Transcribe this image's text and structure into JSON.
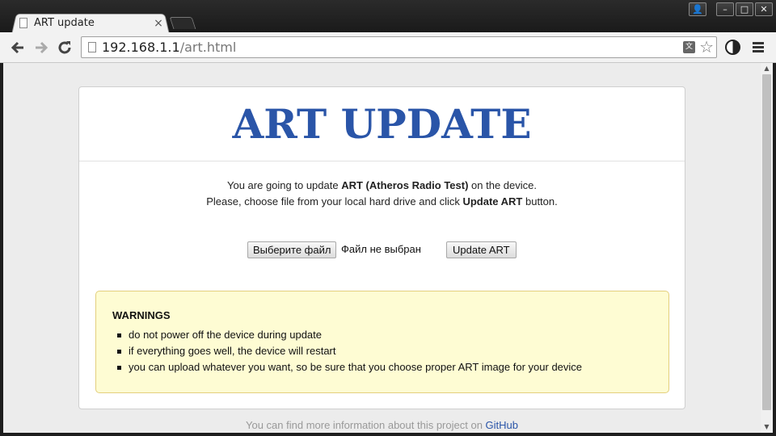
{
  "browser": {
    "tab_title": "ART update",
    "tab_close": "×",
    "url_host": "192.168.1.1",
    "url_path": "/art.html",
    "icons": {
      "back": "back-arrow-icon",
      "forward": "forward-arrow-icon",
      "reload": "reload-icon",
      "translate": "translate-icon",
      "star": "star-icon",
      "extension": "extension-icon",
      "menu": "menu-icon"
    },
    "translate_glyph": "文",
    "star_glyph": "☆",
    "window_controls": {
      "user": "👤",
      "minimize": "–",
      "maximize": "□",
      "close": "✕"
    }
  },
  "page": {
    "title": "ART UPDATE",
    "intro_line1_pre": "You are going to update ",
    "intro_line1_bold": "ART (Atheros Radio Test)",
    "intro_line1_post": " on the device.",
    "intro_line2_pre": "Please, choose file from your local hard drive and click ",
    "intro_line2_bold": "Update ART",
    "intro_line2_post": " button.",
    "file_button": "Выберите файл",
    "file_status": "Файл не выбран",
    "update_button": "Update ART",
    "warnings_title": "WARNINGS",
    "warnings": [
      "do not power off the device during update",
      "if everything goes well, the device will restart",
      "you can upload whatever you want, so be sure that you choose proper ART image for your device"
    ],
    "footer_text": "You can find more information about this project on ",
    "footer_link": "GitHub"
  },
  "colors": {
    "title": "#2a55a8",
    "warning_bg": "#fefcd3",
    "warning_border": "#e3cf7d",
    "link": "#2a55a8"
  }
}
